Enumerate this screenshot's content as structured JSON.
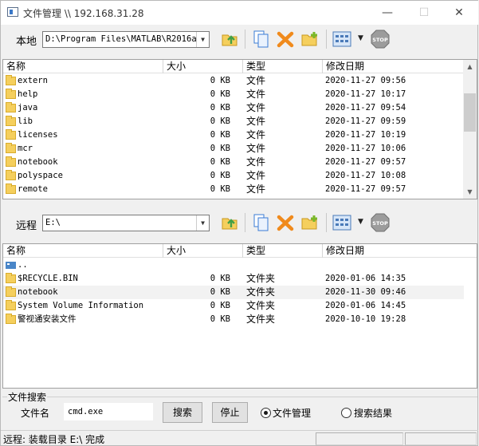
{
  "window": {
    "title": "文件管理 \\\\ 192.168.31.28",
    "min": "—",
    "max": "☐",
    "close": "✕"
  },
  "local": {
    "label": "本地",
    "path": "D:\\Program Files\\MATLAB\\R2016a\\",
    "headers": {
      "name": "名称",
      "size": "大小",
      "type": "类型",
      "date": "修改日期"
    },
    "rows": [
      {
        "name": "extern",
        "size": "0 KB",
        "type": "文件",
        "date": "2020-11-27 09:56"
      },
      {
        "name": "help",
        "size": "0 KB",
        "type": "文件",
        "date": "2020-11-27 10:17"
      },
      {
        "name": "java",
        "size": "0 KB",
        "type": "文件",
        "date": "2020-11-27 09:54"
      },
      {
        "name": "lib",
        "size": "0 KB",
        "type": "文件",
        "date": "2020-11-27 09:59"
      },
      {
        "name": "licenses",
        "size": "0 KB",
        "type": "文件",
        "date": "2020-11-27 10:19"
      },
      {
        "name": "mcr",
        "size": "0 KB",
        "type": "文件",
        "date": "2020-11-27 10:06"
      },
      {
        "name": "notebook",
        "size": "0 KB",
        "type": "文件",
        "date": "2020-11-27 09:57"
      },
      {
        "name": "polyspace",
        "size": "0 KB",
        "type": "文件",
        "date": "2020-11-27 10:08"
      },
      {
        "name": "remote",
        "size": "0 KB",
        "type": "文件",
        "date": "2020-11-27 09:57"
      }
    ]
  },
  "remote": {
    "label": "远程",
    "path": "E:\\",
    "headers": {
      "name": "名称",
      "size": "大小",
      "type": "类型",
      "date": "修改日期"
    },
    "parent": "..",
    "rows": [
      {
        "name": "$RECYCLE.BIN",
        "size": "0 KB",
        "type": "文件夹",
        "date": "2020-01-06 14:35"
      },
      {
        "name": "notebook",
        "size": "0 KB",
        "type": "文件夹",
        "date": "2020-11-30 09:46"
      },
      {
        "name": "System Volume Information",
        "size": "0 KB",
        "type": "文件夹",
        "date": "2020-01-06 14:45"
      },
      {
        "name": "警视通安装文件",
        "size": "0 KB",
        "type": "文件夹",
        "date": "2020-10-10 19:28"
      }
    ]
  },
  "search": {
    "group_label": "文件搜索",
    "filename_label": "文件名",
    "filename_value": "cmd.exe",
    "search_button": "搜索",
    "stop_button": "停止",
    "radio_file_manage": "文件管理",
    "radio_search_results": "搜索结果",
    "selected": "文件管理"
  },
  "status": {
    "text": "远程: 装载目录 E:\\ 完成"
  },
  "colors": {
    "folder": "#f5cf5d",
    "delete": "#f08a1c",
    "upload": "#7bb82a"
  }
}
